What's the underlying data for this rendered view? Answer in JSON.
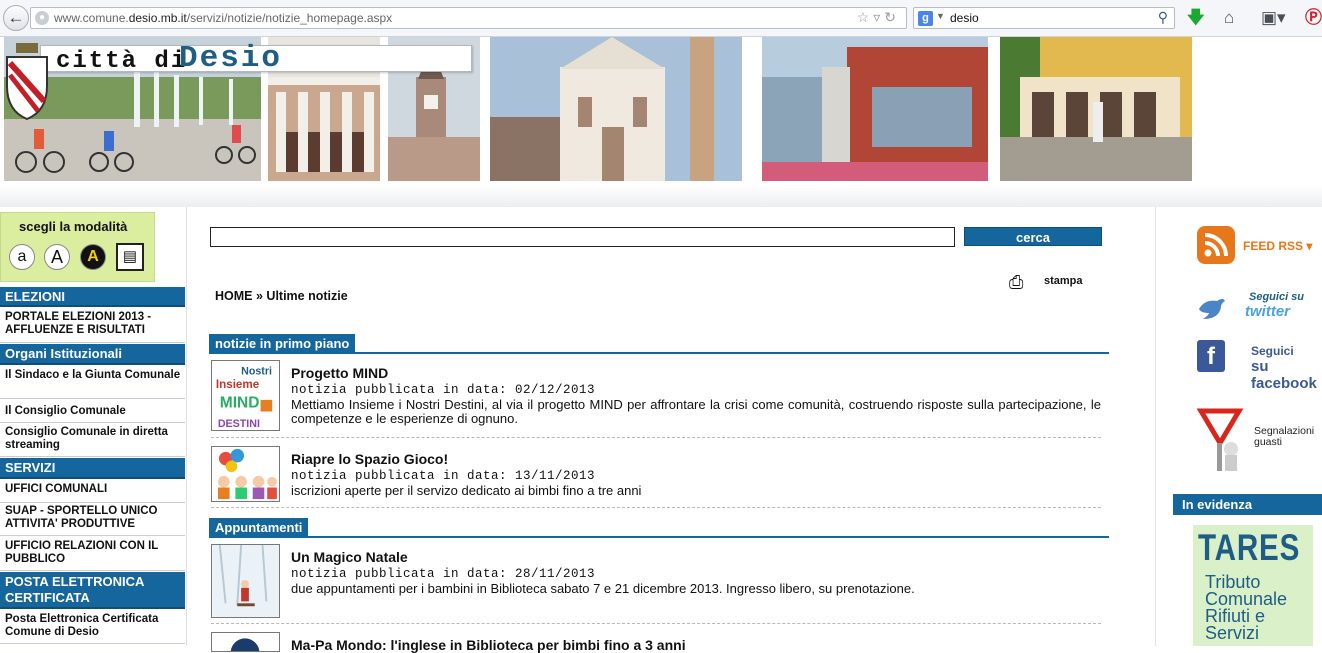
{
  "browser": {
    "url_host": "www.comune.",
    "url_domain": "desio.mb.it",
    "url_path": "/servizi/notizie/notizie_homepage.aspx",
    "search_value": "desio",
    "search_engine_icon": "google-icon",
    "colors": {
      "download": "#1aa832",
      "pinterest": "#cc2127"
    }
  },
  "header": {
    "prefix": "città di",
    "name": "Desio"
  },
  "accessibility": {
    "title": "scegli la modalità",
    "buttons": [
      "a",
      "A",
      "A"
    ]
  },
  "sidebar": {
    "sections": [
      {
        "title": "ELEZIONI",
        "items": [
          "PORTALE ELEZIONI 2013 - AFFLUENZE E RISULTATI"
        ]
      },
      {
        "title": "Organi Istituzionali",
        "items": [
          "Il Sindaco e la Giunta Comunale",
          "Il Consiglio Comunale",
          "Consiglio Comunale in diretta streaming"
        ]
      },
      {
        "title": "SERVIZI",
        "items": [
          "UFFICI COMUNALI",
          "SUAP - SPORTELLO UNICO ATTIVITA' PRODUTTIVE",
          "UFFICIO RELAZIONI CON IL PUBBLICO"
        ]
      },
      {
        "title": "POSTA ELETTRONICA CERTIFICATA",
        "items": [
          "Posta Elettronica Certificata Comune di Desio"
        ]
      }
    ]
  },
  "main": {
    "search_button": "cerca",
    "print_label": "stampa",
    "breadcrumb": {
      "home": "HOME",
      "sep": "»",
      "current": "Ultime notizie"
    },
    "sections": [
      {
        "title": "notizie in primo piano",
        "news": [
          {
            "title": "Progetto MIND",
            "date": "notizia pubblicata in data: 02/12/2013",
            "desc": "Mettiamo Insieme i Nostri Destini, al via il progetto MIND per affrontare la crisi come comunità, costruendo risposte sulla partecipazione, le competenze e le esperienze di ognuno."
          },
          {
            "title": "Riapre lo Spazio Gioco!",
            "date": "notizia pubblicata in data: 13/11/2013",
            "desc": "iscrizioni aperte per il servizo dedicato ai bimbi fino a tre anni"
          }
        ]
      },
      {
        "title": "Appuntamenti",
        "news": [
          {
            "title": "Un Magico Natale",
            "date": "notizia pubblicata in data: 28/11/2013",
            "desc": "due appuntamenti per i bambini in Biblioteca sabato 7 e 21 dicembre 2013. Ingresso libero, su prenotazione."
          },
          {
            "title": "Ma-Pa Mondo: l'inglese in Biblioteca per bimbi fino a 3 anni",
            "date": "",
            "desc": ""
          }
        ]
      }
    ]
  },
  "right": {
    "rss": "FEED RSS",
    "twitter_1": "Seguici su",
    "twitter_2": "twitter",
    "facebook_1": "Seguici",
    "facebook_2": "su facebook",
    "segnalazioni_1": "Segnalazioni",
    "segnalazioni_2": "guasti",
    "evidenza": "In evidenza",
    "tares_title": "TARES",
    "tares_lines": [
      "Tributo",
      "Comunale",
      "Rifiuti e",
      "Servizi"
    ]
  },
  "colors": {
    "primary": "#15669c",
    "mode_bg": "#dbeea0",
    "rss": "#e8761a",
    "facebook": "#3b5998"
  }
}
